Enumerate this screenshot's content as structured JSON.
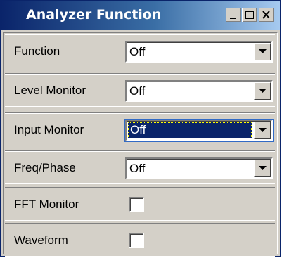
{
  "window": {
    "title": "Analyzer Function",
    "controls": [
      "minimize-icon",
      "maximize-icon",
      "close-icon"
    ]
  },
  "rows": [
    {
      "label": "Function",
      "type": "dropdown",
      "value": "Off",
      "focused": false
    },
    {
      "label": "Level Monitor",
      "type": "dropdown",
      "value": "Off",
      "focused": false
    },
    {
      "label": "Input Monitor",
      "type": "dropdown",
      "value": "Off",
      "focused": true
    },
    {
      "label": "Freq/Phase",
      "type": "dropdown",
      "value": "Off",
      "focused": false
    },
    {
      "label": "FFT Monitor",
      "type": "checkbox",
      "checked": false
    },
    {
      "label": "Waveform",
      "type": "checkbox",
      "checked": false
    }
  ],
  "colors": {
    "title_bar_start": "#0a246a",
    "title_bar_end": "#a6caf0",
    "face": "#d4d0c8",
    "selection": "#0a246a"
  }
}
